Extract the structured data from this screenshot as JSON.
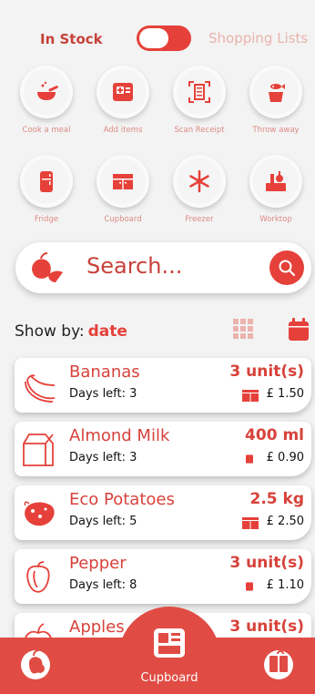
{
  "toggle": {
    "left_label": "In Stock",
    "right_label": "Shopping Lists",
    "state": "on"
  },
  "actions": [
    {
      "label": "Cook a meal",
      "icon": "cooking-pot-icon"
    },
    {
      "label": "Add items",
      "icon": "add-items-icon"
    },
    {
      "label": "Scan Receipt",
      "icon": "scan-receipt-icon"
    },
    {
      "label": "Throw away",
      "icon": "trash-fish-icon"
    }
  ],
  "storage": [
    {
      "label": "Fridge",
      "icon": "fridge-icon"
    },
    {
      "label": "Cupboard",
      "icon": "cupboard-icon"
    },
    {
      "label": "Freezer",
      "icon": "snowflake-icon"
    },
    {
      "label": "Worktop",
      "icon": "worktop-icon"
    }
  ],
  "search": {
    "placeholder": "Search..."
  },
  "sort": {
    "label": "Show by:",
    "value": "date"
  },
  "items": [
    {
      "name": "Bananas",
      "days": "Days left: 3",
      "qty": "3 unit(s)",
      "price": "£ 1.50",
      "location": "cupboard-icon",
      "icon": "banana-icon"
    },
    {
      "name": "Almond Milk",
      "days": "Days left: 3",
      "qty": "400 ml",
      "price": "£ 0.90",
      "location": "fridge-icon",
      "icon": "milk-carton-icon"
    },
    {
      "name": "Eco Potatoes",
      "days": "Days left: 5",
      "qty": "2.5 kg",
      "price": "£ 2.50",
      "location": "cupboard-icon",
      "icon": "potato-icon"
    },
    {
      "name": "Pepper",
      "days": "Days left: 8",
      "qty": "3 unit(s)",
      "price": "£ 1.10",
      "location": "fridge-icon",
      "icon": "pepper-icon"
    },
    {
      "name": "Apples",
      "days": "",
      "qty": "3 unit(s)",
      "price": "",
      "location": "",
      "icon": "apple-icon"
    }
  ],
  "nav": {
    "center_label": "Cupboard"
  },
  "colors": {
    "accent": "#e5413a",
    "muted": "#dc8a83",
    "background": "#f3f3f3"
  }
}
